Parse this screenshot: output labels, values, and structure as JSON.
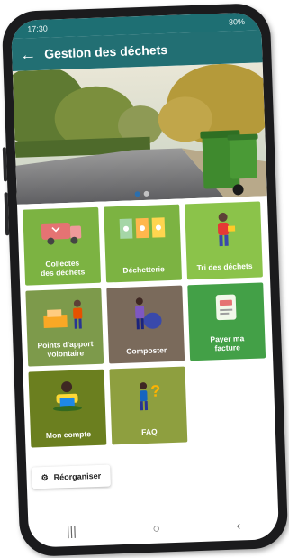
{
  "status": {
    "time": "17:30",
    "battery": "80%"
  },
  "appbar": {
    "title": "Gestion des déchets"
  },
  "tiles": [
    {
      "label": "Collectes\ndes déchets",
      "color": "#7cb342",
      "icon": "garbage-truck-icon"
    },
    {
      "label": "Déchetterie",
      "color": "#7cb342",
      "icon": "recycling-bins-icon"
    },
    {
      "label": "Tri des déchets",
      "color": "#8bc34a",
      "icon": "person-sorting-icon"
    },
    {
      "label": "Points d'apport\nvolontaire",
      "color": "#7d9a4b",
      "icon": "drop-off-point-icon"
    },
    {
      "label": "Composter",
      "color": "#7a6a5b",
      "icon": "composting-icon"
    },
    {
      "label": "Payer ma\nfacture",
      "color": "#43a047",
      "icon": "bill-payment-icon"
    },
    {
      "label": "Mon compte",
      "color": "#6b7f1f",
      "icon": "user-account-icon"
    },
    {
      "label": "FAQ",
      "color": "#8e9f3f",
      "icon": "faq-icon"
    }
  ],
  "reorganize": {
    "label": "Réorganiser"
  },
  "carousel": {
    "active_index": 1,
    "count": 2
  }
}
